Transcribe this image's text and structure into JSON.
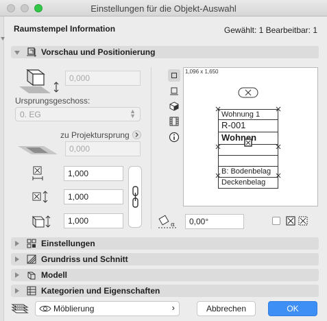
{
  "window": {
    "title": "Einstellungen für die Objekt-Auswahl"
  },
  "header": {
    "title": "Raumstempel Information",
    "selection": "Gewählt: 1 Bearbeitbar: 1"
  },
  "sections": {
    "preview_positioning": "Vorschau und Positionierung",
    "settings": "Einstellungen",
    "floorplan_section": "Grundriss und Schnitt",
    "model": "Modell",
    "categories_properties": "Kategorien und Eigenschaften"
  },
  "positioning": {
    "elevation_value": "0,000",
    "origin_story_label": "Ursprungsgeschoss:",
    "origin_story_value": "0. EG",
    "project_origin_label": "zu Projektursprung",
    "project_origin_value": "0,000",
    "size_x": "1,000",
    "size_y": "1,000",
    "size_z": "1,000",
    "rotation_value": "0,00°"
  },
  "preview": {
    "dimensions": "1,096 x 1,650",
    "stamp_rows": [
      "Wohnung 1",
      "R-001",
      "Wohnen",
      "",
      "",
      "B: Bodenbelag",
      "Deckenbelag"
    ]
  },
  "footer": {
    "layer_value": "Möblierung",
    "cancel_label": "Abbrechen",
    "ok_label": "OK"
  }
}
